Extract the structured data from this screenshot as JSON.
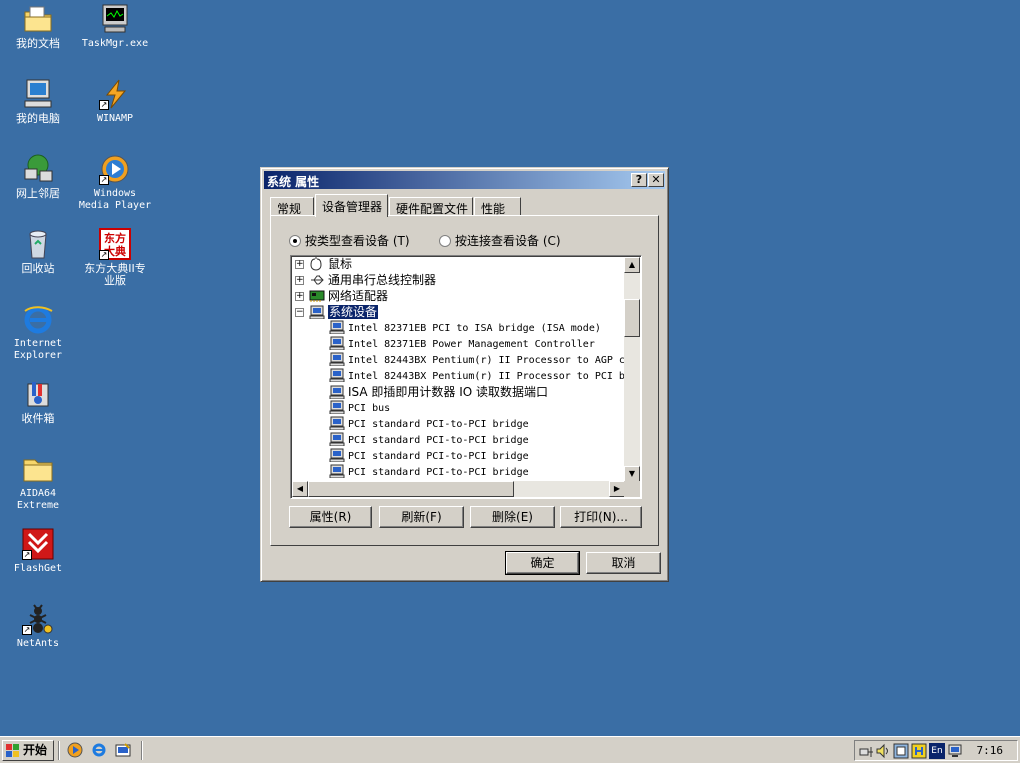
{
  "desktop": {
    "icons": [
      {
        "label": "我的文档",
        "icon": "my-documents-icon"
      },
      {
        "label": "TaskMgr.exe",
        "icon": "task-manager-icon"
      },
      {
        "label": "我的电脑",
        "icon": "my-computer-icon"
      },
      {
        "label": "WINAMP",
        "icon": "winamp-icon"
      },
      {
        "label": "网上邻居",
        "icon": "network-places-icon"
      },
      {
        "label": "Windows\nMedia Player",
        "icon": "media-player-icon"
      },
      {
        "label": "回收站",
        "icon": "recycle-bin-icon"
      },
      {
        "label": "东方大典II专\n业版",
        "icon": "dictionary-icon"
      },
      {
        "label": "Internet\nExplorer",
        "icon": "ie-icon"
      },
      {
        "label": "收件箱",
        "icon": "inbox-icon"
      },
      {
        "label": "AIDA64\nExtreme",
        "icon": "folder-icon"
      },
      {
        "label": "FlashGet",
        "icon": "flashget-icon"
      },
      {
        "label": "NetAnts",
        "icon": "netants-icon"
      }
    ]
  },
  "window": {
    "title": "系统 属性",
    "help_btn": "?",
    "close_btn": "✕",
    "tabs": [
      "常规",
      "设备管理器",
      "硬件配置文件",
      "性能"
    ],
    "active_tab": 1,
    "radio_by_type": "按类型查看设备 (T)",
    "radio_by_connection": "按连接查看设备 (C)",
    "tree": {
      "categories": [
        "鼠标",
        "通用串行总线控制器",
        "网络适配器",
        "系统设备"
      ],
      "devices": [
        "Intel 82371EB PCI to ISA bridge (ISA mode)",
        "Intel 82371EB Power Management Controller",
        "Intel 82443BX Pentium(r) II Processor to AGP c",
        "Intel 82443BX Pentium(r) II Processor to PCI b",
        "ISA 即插即用计数器 IO 读取数据端口",
        "PCI bus",
        "PCI standard PCI-to-PCI bridge",
        "PCI standard PCI-to-PCI bridge",
        "PCI standard PCI-to-PCI bridge",
        "PCI standard PCI-to-PCI bridge"
      ]
    },
    "buttons": {
      "properties": "属性(R)",
      "refresh": "刷新(F)",
      "remove": "删除(E)",
      "print": "打印(N)...",
      "ok": "确定",
      "cancel": "取消"
    }
  },
  "taskbar": {
    "start": "开始",
    "clock": "7:16",
    "tray_lang": "En"
  }
}
